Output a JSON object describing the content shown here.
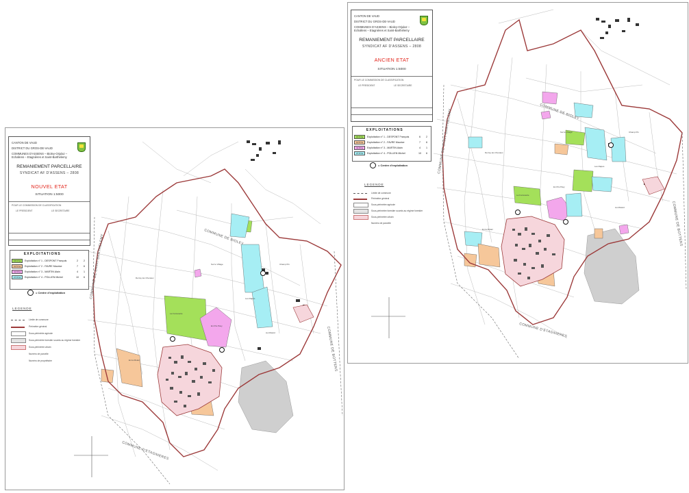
{
  "colors": {
    "perimeter": "#9c3a3a",
    "green": "#a4e05a",
    "orange": "#f6c79a",
    "magenta": "#f3a7ec",
    "cyan": "#a6eef4",
    "village_pink": "#f6d6dc",
    "relief_gray": "#cfcfcf"
  },
  "sheets": [
    {
      "id": "new",
      "header": {
        "canton": "CANTON DE VAUD",
        "district": "DISTRICT DU GROS-DE-VAUD",
        "communes_line1": "COMMUNES D'ASSENS – Bioley-Orjulaz –",
        "communes_line2": "Echallens – Etagnières et Saint-Barthélemy",
        "title": "REMANIEMENT PARCELLAIRE",
        "syndicate": "SYNDICAT AF D'ASSENS – 2808",
        "state": "NOUVEL ETAT",
        "scale": "SITUATION 1:5000",
        "committee": "POUR LE COMMISSION DE CLASSIFICATION",
        "president": "LE PRESIDENT",
        "secretary": "LE SECRETAIRE"
      },
      "exploitations": {
        "title": "EXPLOITATIONS",
        "rows": [
          {
            "area": "16.6 ha",
            "name": "Exploitation n° 1 - DESPONT François",
            "n1": "2",
            "n2": "2",
            "color": "#a4e05a"
          },
          {
            "area": "10.5 ha",
            "name": "Exploitation n° 2 - FAVRE Maurice",
            "n1": "7",
            "n2": "6",
            "color": "#f6c79a"
          },
          {
            "area": "11.9 ha",
            "name": "Exploitation n° 3 - MARTIN Alain",
            "n1": "4",
            "n2": "1",
            "color": "#f3a7ec"
          },
          {
            "area": "27.8 ha",
            "name": "Exploitation n° 4 - POLLIEN Michel",
            "n1": "10",
            "n2": "6",
            "color": "#a6eef4"
          }
        ],
        "centre_label": "= Centre d'exploitation"
      },
      "legend": {
        "title": "LEGENDE",
        "items": [
          "Limite de commune",
          "Périmètre général",
          "Sous-périmètre agricole",
          "Sous-périmètre forestier soumis au régime forestier",
          "Sous-périmètre urbain",
          "Numéro de parcelle",
          "Numéro de propriétaire"
        ]
      },
      "map_labels": {
        "commune_a": "COMMUNE DE SAINT-BARTHELEMY",
        "commune_b": "COMMUNE D'ETAGNIERES",
        "commune_c": "COMMUNE DE BOTTENS",
        "commune_d": "COMMUNE DE BIOLEY",
        "fields": [
          "La Fontanette",
          "Derrey les Chenaux",
          "En Pra Pavy",
          "Les Rapes",
          "Au Molard",
          "En la Mutaz",
          "Champ Pin",
          "Sur le Village"
        ]
      }
    },
    {
      "id": "old",
      "header": {
        "canton": "CANTON DE VAUD",
        "district": "DISTRICT DU GROS-DE-VAUD",
        "communes_line1": "COMMUNES D'ASSENS – Bioley-Orjulaz –",
        "communes_line2": "Echallens – Etagnières et Saint-Barthélemy",
        "title": "REMANIEMENT PARCELLAIRE",
        "syndicate": "SYNDICAT AF D'ASSENS – 2808",
        "state": "ANCIEN ETAT",
        "scale": "SITUATION 1:5000",
        "committee": "POUR LE COMMISSION DE CLASSIFICATION",
        "president": "LE PRESIDENT",
        "secretary": "LE SECRETAIRE"
      },
      "exploitations": {
        "title": "EXPLOITATIONS",
        "rows": [
          {
            "area": "16.6 ha",
            "name": "Exploitation n° 1 - DESPONT François",
            "n1": "6",
            "n2": "2",
            "color": "#a4e05a"
          },
          {
            "area": "10.5 ha",
            "name": "Exploitation n° 2 - FAVRE Maurice",
            "n1": "7",
            "n2": "6",
            "color": "#f6c79a"
          },
          {
            "area": "11.9 ha",
            "name": "Exploitation n° 3 - MARTIN Alain",
            "n1": "4",
            "n2": "1",
            "color": "#f3a7ec"
          },
          {
            "area": "27.8 ha",
            "name": "Exploitation n° 4 - POLLIEN Michel",
            "n1": "10",
            "n2": "6",
            "color": "#a6eef4"
          }
        ],
        "centre_label": "= Centre d'exploitation"
      },
      "legend": {
        "title": "LEGENDE",
        "items": [
          "Limite de commune",
          "Périmètre général",
          "Sous-périmètre agricole",
          "Sous-périmètre forestier soumis au régime forestier",
          "Sous-périmètre urbain",
          "Numéro de parcelle"
        ]
      },
      "map_labels": {
        "commune_a": "COMMUNE DE BIOLEY",
        "commune_b": "COMMUNE D'ETAGNIERES",
        "commune_c": "COMMUNE DE BOTTENS",
        "commune_d": "COMMUNE DE SAINT-BARTHELEMY",
        "fields": [
          "La Fontanette",
          "Derrey les Chenaux",
          "En Pra Pavy",
          "Les Rapes",
          "Au Molard",
          "En la Mutaz",
          "Champ Pin",
          "Sur le Village"
        ]
      }
    }
  ]
}
